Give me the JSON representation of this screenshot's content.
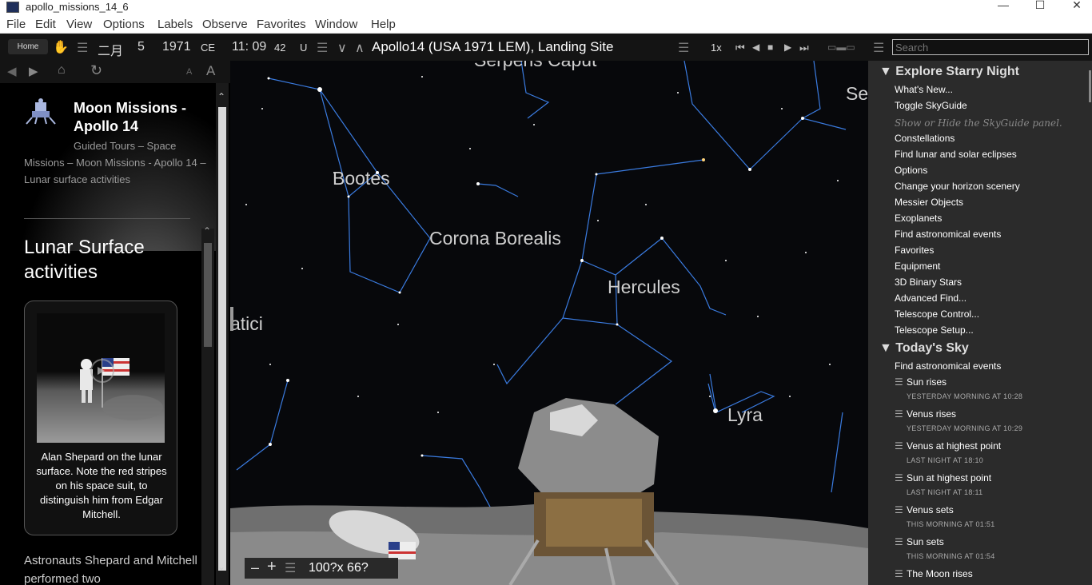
{
  "window": {
    "title": "apollo_missions_14_6"
  },
  "menu": [
    "File",
    "Edit",
    "View",
    "Options",
    "Labels",
    "Observe",
    "Favorites",
    "Window",
    "Help"
  ],
  "toolbar": {
    "home": "Home",
    "month": "二月",
    "day": "5",
    "year": "1971",
    "era": "CE",
    "time": "11: 09",
    "seconds": "42",
    "tz": "U",
    "location": "Apollo14 (USA 1971 LEM), Landing Site",
    "rate": "1x",
    "search_placeholder": "Search"
  },
  "left": {
    "mission_title": "Moon Missions - Apollo 14",
    "breadcrumb": "Guided Tours – Space Missions – Moon Missions - Apollo 14 – Lunar surface activities",
    "section_title": "Lunar Surface activities",
    "caption": "Alan Shepard on the lunar surface. Note the red stripes on his space suit, to distinguish him from Edgar Mitchell.",
    "body": "Astronauts Shepard and Mitchell performed two"
  },
  "sky": {
    "labels": [
      "Serpens Caput",
      "Bootes",
      "Corona Borealis",
      "Hercules",
      "Lyra",
      "atici",
      "Se"
    ],
    "zoom_readout": "100?x 66?"
  },
  "right": {
    "explore_header": "Explore Starry Night",
    "explore_items": [
      "What's New...",
      "Toggle SkyGuide"
    ],
    "explore_note": "Show or Hide the SkyGuide panel.",
    "explore_items2": [
      "Constellations",
      "Find lunar and solar eclipses",
      "Options",
      "Change your horizon scenery",
      "Messier Objects",
      "Exoplanets",
      "Find astronomical events",
      "Favorites",
      "Equipment",
      "3D Binary Stars",
      "Advanced Find...",
      "Telescope Control...",
      "Telescope Setup..."
    ],
    "today_header": "Today's Sky",
    "today_first": "Find astronomical events",
    "events": [
      {
        "name": "Sun rises",
        "when": "YESTERDAY MORNING AT 10:28"
      },
      {
        "name": "Venus rises",
        "when": "YESTERDAY MORNING AT 10:29"
      },
      {
        "name": "Venus at highest point",
        "when": "LAST NIGHT AT 18:10"
      },
      {
        "name": "Sun at highest point",
        "when": "LAST NIGHT AT 18:11"
      },
      {
        "name": "Venus sets",
        "when": "THIS MORNING AT 01:51"
      },
      {
        "name": "Sun sets",
        "when": "THIS MORNING AT 01:54"
      },
      {
        "name": "The Moon rises",
        "when": ""
      }
    ]
  }
}
